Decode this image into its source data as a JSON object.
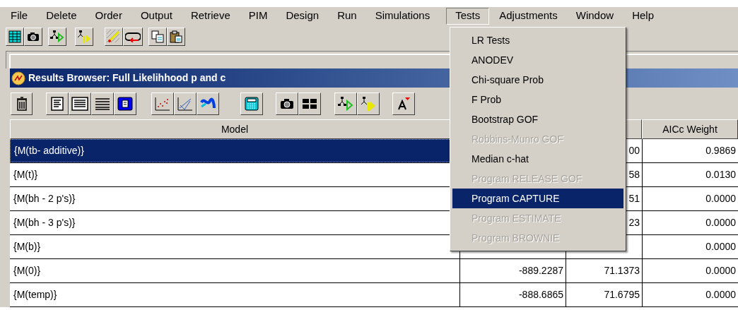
{
  "menu_bar": [
    {
      "label": "File",
      "selected": false
    },
    {
      "label": "Delete",
      "selected": false
    },
    {
      "label": "Order",
      "selected": false
    },
    {
      "label": "Output",
      "selected": false
    },
    {
      "label": "Retrieve",
      "selected": false
    },
    {
      "label": "PIM",
      "selected": false
    },
    {
      "label": "Design",
      "selected": false
    },
    {
      "label": "Run",
      "selected": false
    },
    {
      "label": "Simulations",
      "selected": false
    },
    {
      "label": "Tests",
      "selected": true
    },
    {
      "label": "Adjustments",
      "selected": false
    },
    {
      "label": "Window",
      "selected": false
    },
    {
      "label": "Help",
      "selected": false
    }
  ],
  "tests_menu": {
    "items": [
      {
        "label": "LR Tests",
        "disabled": false,
        "selected": false
      },
      {
        "label": "ANODEV",
        "disabled": false,
        "selected": false
      },
      {
        "label": "Chi-square Prob",
        "disabled": false,
        "selected": false
      },
      {
        "label": "F Prob",
        "disabled": false,
        "selected": false
      },
      {
        "label": "Bootstrap GOF",
        "disabled": false,
        "selected": false
      },
      {
        "label": "Robbins-Munro GOF",
        "disabled": true,
        "selected": false
      },
      {
        "label": "Median c-hat",
        "disabled": false,
        "selected": false
      },
      {
        "label": "Program RELEASE GOF",
        "disabled": true,
        "selected": false
      },
      {
        "label": "Program CAPTURE",
        "disabled": false,
        "selected": true
      },
      {
        "label": "Program ESTIMATE",
        "disabled": true,
        "selected": false
      },
      {
        "label": "Program BROWNIE",
        "disabled": true,
        "selected": false
      }
    ]
  },
  "results_browser": {
    "title": "Results Browser: Full Likelihhood p and c",
    "table": {
      "columns": {
        "model": "Model",
        "aicc_weight": "AICc Weight"
      },
      "rows": [
        {
          "model": "{M(tb- additive)}",
          "column_3": "00",
          "aicc_weight": "0.9869",
          "selected": true
        },
        {
          "model": "{M(t)}",
          "column_3": "58",
          "aicc_weight": "0.0130",
          "selected": false
        },
        {
          "model": "{M(bh - 2 p's)}",
          "column_3": "51",
          "aicc_weight": "0.0000",
          "selected": false
        },
        {
          "model": "{M(bh - 3 p's)}",
          "column_3": "23",
          "aicc_weight": "0.0000",
          "selected": false
        },
        {
          "model": "{M(b)}",
          "aicc_weight": "0.0000",
          "selected": false
        },
        {
          "model": "{M(0)}",
          "column_2": "-889.2287",
          "column_3": "71.1373",
          "aicc_weight": "0.0000",
          "selected": false
        },
        {
          "model": "{M(temp)}",
          "column_2": "-888.6865",
          "column_3": "71.6795",
          "aicc_weight": "0.0000",
          "selected": false
        }
      ]
    }
  }
}
